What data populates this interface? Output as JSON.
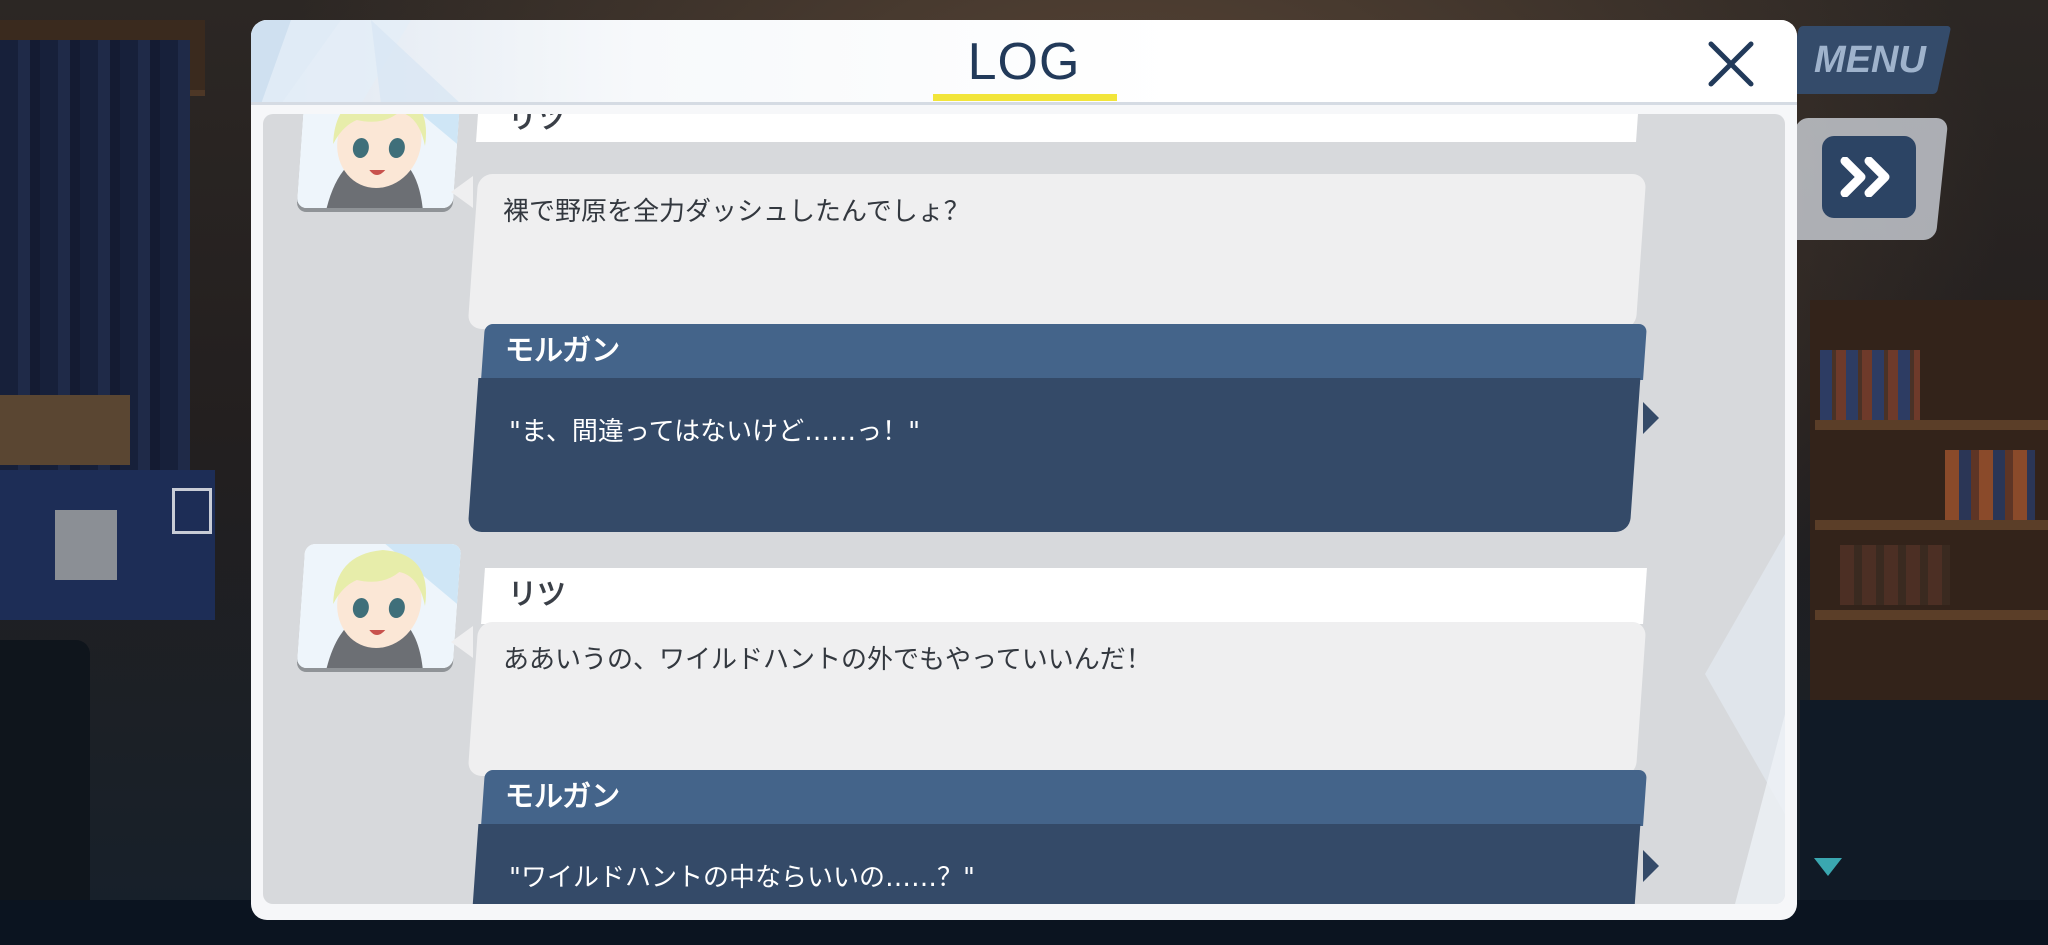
{
  "header": {
    "title": "LOG"
  },
  "outside": {
    "menu_label": "MENU"
  },
  "icons": {
    "close": "close-icon",
    "fast_forward": "fast-forward-icon",
    "scroll_down": "triangle-down-icon"
  },
  "colors": {
    "title_text": "#223a5a",
    "title_underline": "#f2e53a",
    "npc_bubble": "#efeff0",
    "player_namebar": "#44648a",
    "player_bubble": "#344a68",
    "scroll_indicator": "#3aa7b0"
  },
  "log": {
    "entries": [
      {
        "speaker": "リツ",
        "text": "裸で野原を全力ダッシュしたんでしょ？",
        "style": "npc",
        "avatar": "ritsu-avatar"
      },
      {
        "speaker": "モルガン",
        "text": "\"ま、間違ってはないけど……っ！\"",
        "style": "player"
      },
      {
        "speaker": "リツ",
        "text": "ああいうの、ワイルドハントの外でもやっていいんだ！",
        "style": "npc",
        "avatar": "ritsu-avatar"
      },
      {
        "speaker": "モルガン",
        "text": "\"ワイルドハントの中ならいいの……？\"",
        "style": "player"
      }
    ]
  }
}
